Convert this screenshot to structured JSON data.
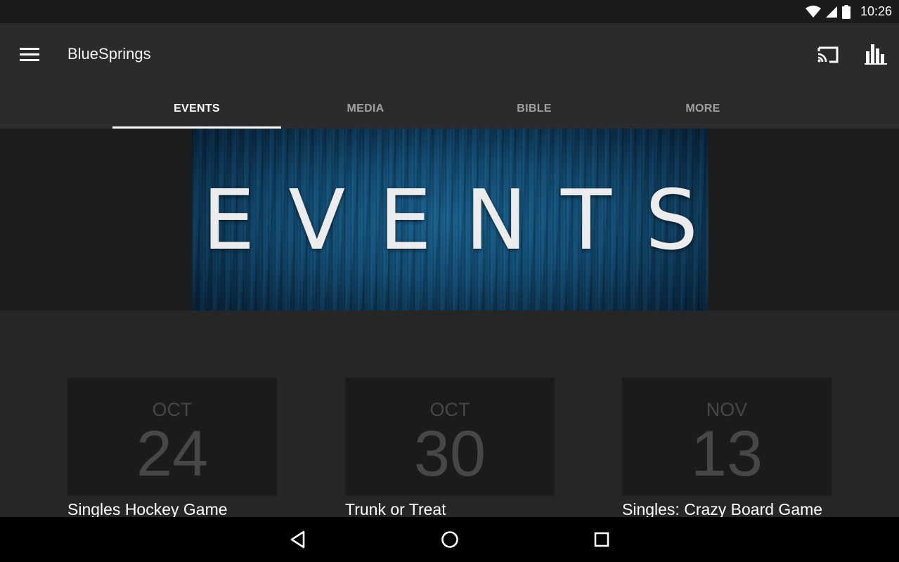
{
  "status_bar": {
    "time": "10:26"
  },
  "app_bar": {
    "title": "BlueSprings"
  },
  "tabs": [
    {
      "label": "EVENTS",
      "active": true
    },
    {
      "label": "MEDIA",
      "active": false
    },
    {
      "label": "BIBLE",
      "active": false
    },
    {
      "label": "MORE",
      "active": false
    }
  ],
  "hero": {
    "text": "EVENTS"
  },
  "events": [
    {
      "month": "OCT",
      "day": "24",
      "title": "Singles Hockey Game"
    },
    {
      "month": "OCT",
      "day": "30",
      "title": "Trunk or Treat"
    },
    {
      "month": "NOV",
      "day": "13",
      "title": "Singles: Crazy Board Game"
    }
  ],
  "icons": {
    "menu": "hamburger-menu-icon",
    "cast": "cast-icon",
    "stats": "bar-chart-icon",
    "back": "back-triangle-icon",
    "home": "home-circle-icon",
    "recents": "recents-square-icon"
  },
  "colors": {
    "accent": "#ffffff",
    "app_bar": "#2b2b2d",
    "background": "#262626",
    "hero_blue": "#1a6491"
  }
}
